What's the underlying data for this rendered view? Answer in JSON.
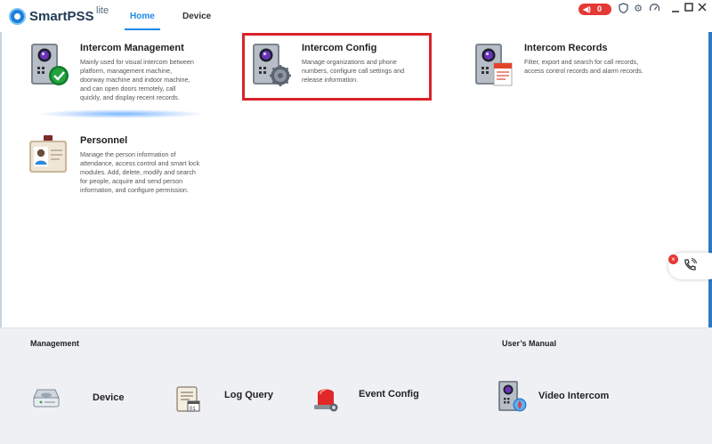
{
  "app": {
    "brand": "SmartPSS",
    "brand_suffix": "lite",
    "accent_color": "#1e88e5"
  },
  "nav": {
    "home": "Home",
    "device": "Device"
  },
  "titlebar": {
    "alarm_count": "0",
    "icons": [
      "speaker-icon",
      "shield-icon",
      "gear-icon",
      "gauge-icon",
      "minimize-icon",
      "maximize-icon",
      "close-icon"
    ]
  },
  "modules": {
    "intercom_management": {
      "title": "Intercom Management",
      "desc": "Mainly used for visual intercom between\nplatform, management machine,\ndoorway machine and indoor machine,\nand can open doors remotely, call\nquickly, and display recent records."
    },
    "intercom_config": {
      "title": "Intercom Config",
      "desc": "Manage organizations and phone\nnumbers, configure call settings and\nrelease information."
    },
    "intercom_records": {
      "title": "Intercom Records",
      "desc": "Filter, export and search for call records,\naccess control records and alarm records."
    },
    "personnel": {
      "title": "Personnel",
      "desc": "Manage the person information of\nattendance, access control and smart lock\nmodules. Add, delete, modify and search\nfor people, acquire and send person\ninformation, and configure permission."
    }
  },
  "management": {
    "title": "Management",
    "items": {
      "device": "Device",
      "log_query": "Log Query",
      "event_config": "Event Config"
    }
  },
  "manual": {
    "title": "User’s Manual",
    "items": {
      "video_intercom": "Video Intercom"
    }
  },
  "colors": {
    "highlight_border": "#d9232a",
    "alarm_badge": "#e53935",
    "bottom_panel": "#eef0f3"
  }
}
